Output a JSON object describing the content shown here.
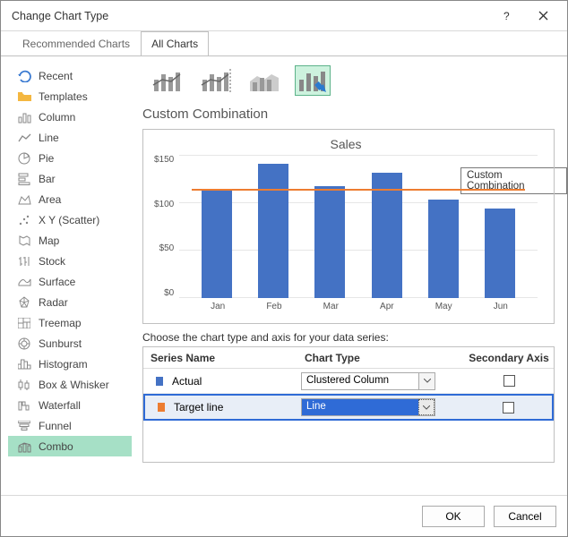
{
  "title": "Change Chart Type",
  "tabs": {
    "recommended": "Recommended Charts",
    "all": "All Charts"
  },
  "sidebar": {
    "items": [
      "Recent",
      "Templates",
      "Column",
      "Line",
      "Pie",
      "Bar",
      "Area",
      "X Y (Scatter)",
      "Map",
      "Stock",
      "Surface",
      "Radar",
      "Treemap",
      "Sunburst",
      "Histogram",
      "Box & Whisker",
      "Waterfall",
      "Funnel",
      "Combo"
    ]
  },
  "section_title": "Custom Combination",
  "tooltip": "Custom Combination",
  "choose_label": "Choose the chart type and axis for your data series:",
  "headers": {
    "series": "Series Name",
    "charttype": "Chart Type",
    "axis": "Secondary Axis"
  },
  "series": [
    {
      "name": "Actual",
      "type": "Clustered Column",
      "color": "#4472c4"
    },
    {
      "name": "Target line",
      "type": "Line",
      "color": "#ed7d31"
    }
  ],
  "buttons": {
    "ok": "OK",
    "cancel": "Cancel"
  },
  "chart_data": {
    "type": "bar",
    "title": "Sales",
    "categories": [
      "Jan",
      "Feb",
      "Mar",
      "Apr",
      "May",
      "Jun"
    ],
    "values": [
      120,
      150,
      125,
      140,
      110,
      100
    ],
    "target": 120,
    "ylabel": "",
    "yticks": [
      "$150",
      "$100",
      "$50",
      "$0"
    ],
    "ylim": [
      0,
      160
    ]
  }
}
